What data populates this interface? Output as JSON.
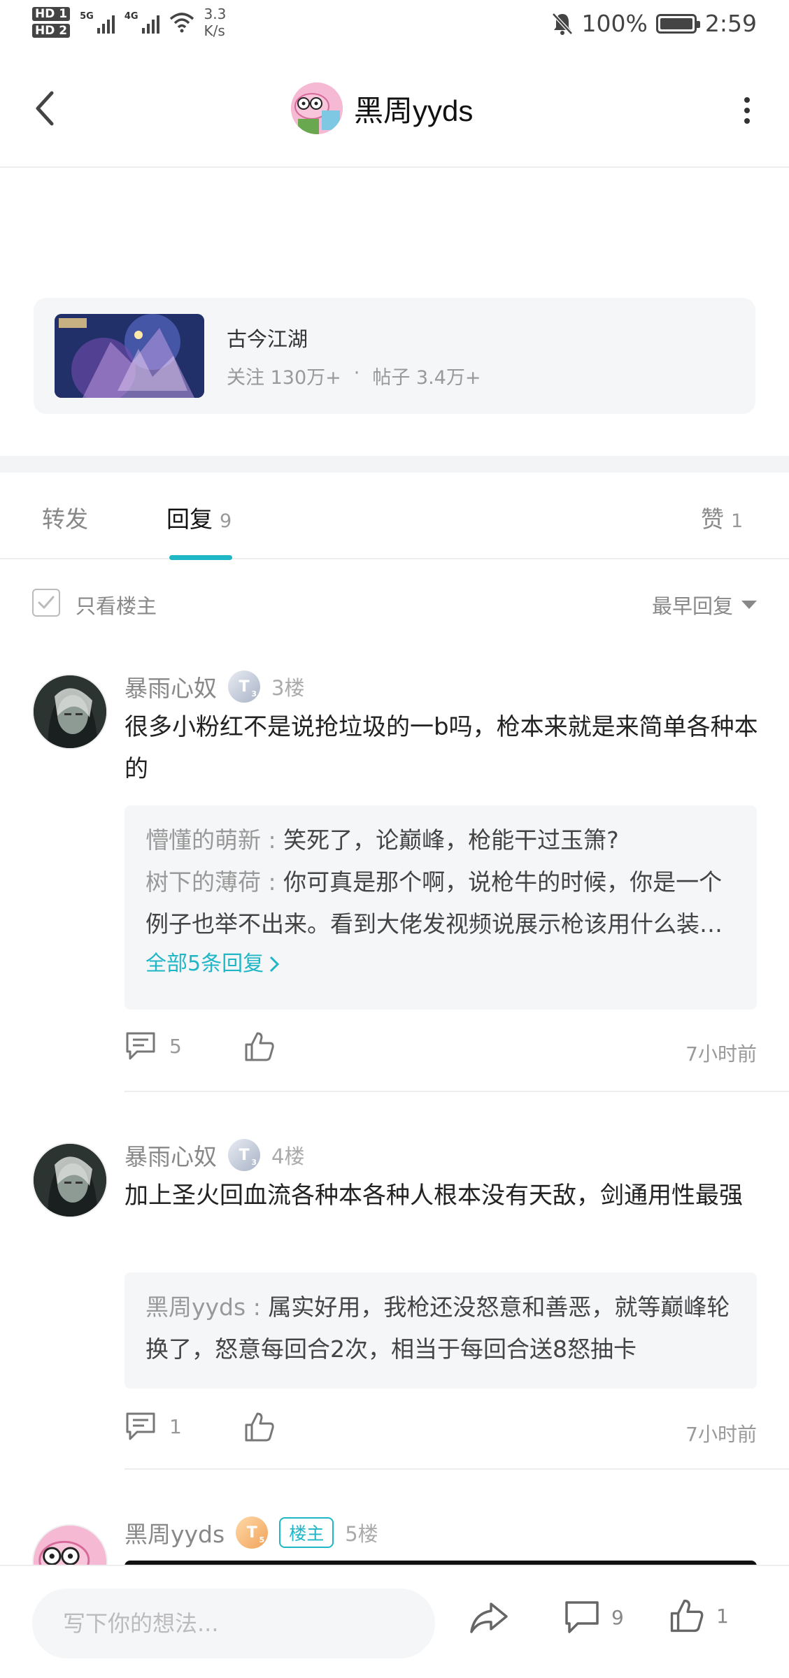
{
  "status_bar": {
    "hd1": "HD 1",
    "hd2": "HD 2",
    "net1": "5G",
    "net2": "4G",
    "speed_value": "3.3",
    "speed_unit": "K/s",
    "battery_pct": "100%",
    "time": "2:59"
  },
  "header": {
    "title": "黑周yyds",
    "back_icon": "chevron-left-icon",
    "more_icon": "more-vertical-icon"
  },
  "forum": {
    "name": "古今江湖",
    "follow_label": "关注 130万+",
    "separator": "·",
    "posts_label": "帖子 3.4万+"
  },
  "tabs": {
    "forward": "转发",
    "reply": "回复",
    "reply_count": "9",
    "like": "赞",
    "like_count": "1"
  },
  "filter": {
    "only_owner": "只看楼主",
    "only_owner_checked": true,
    "sort": "最早回复"
  },
  "comments": [
    {
      "author": "暴雨心奴",
      "level": "T",
      "level_num": "3",
      "floor": "3楼",
      "text": "很多小粉红不是说抢垃圾的一b吗，枪本来就是来简单各种本的",
      "replies": [
        {
          "author": "懵懂的萌新",
          "sep": " : ",
          "text": "笑死了，论巅峰，枪能干过玉箫?"
        },
        {
          "author": "树下的薄荷",
          "sep": " : ",
          "text": "你可真是那个啊，说枪牛的时候，你是一个例子也举不出来。看到大佬发视频说展示枪该用什么装备什么技能的时候"
        }
      ],
      "view_all": "全部5条回复",
      "reply_count": "5",
      "time": "7小时前"
    },
    {
      "author": "暴雨心奴",
      "level": "T",
      "level_num": "3",
      "floor": "4楼",
      "text": "加上圣火回血流各种本各种人根本没有天敌，剑通用性最强",
      "replies": [
        {
          "author": "黑周yyds",
          "sep": " : ",
          "text": "属实好用，我枪还没怒意和善恶，就等巅峰轮换了，怒意每回合2次，相当于每回合送8怒抽卡"
        }
      ],
      "reply_count": "1",
      "time": "7小时前"
    },
    {
      "author": "黑周yyds",
      "level": "T",
      "level_num": "5",
      "owner_badge": "楼主",
      "floor": "5楼"
    }
  ],
  "bottom_bar": {
    "input_placeholder": "写下你的想法...",
    "comment_count": "9",
    "like_count": "1"
  },
  "colors": {
    "accent": "#1fb6c6",
    "muted_text": "#999999",
    "panel_bg": "#f5f6f8"
  }
}
